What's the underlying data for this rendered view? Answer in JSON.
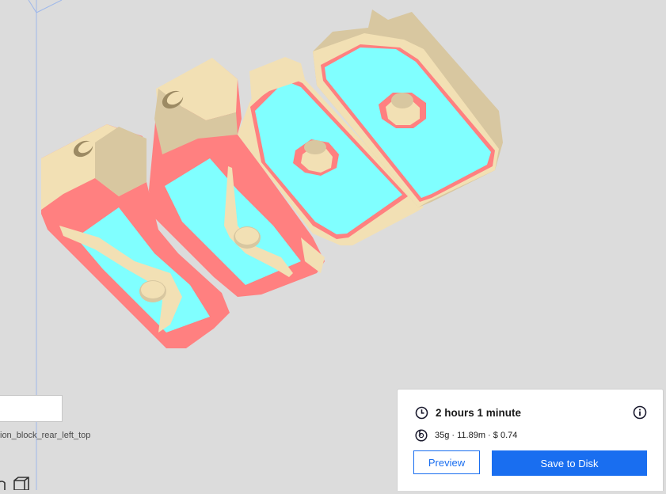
{
  "scene": {
    "object_name_field_value": "",
    "object_name_label": "ion_block_rear_left_top",
    "colors": {
      "background": "#dcdcdc",
      "model_top": "#f2e0b4",
      "model_side": "#d8c7a0",
      "overhang": "#ff8080",
      "top_surface": "#80ffff",
      "build_volume_line": "#9fb8ea"
    }
  },
  "print_panel": {
    "time_icon": "clock-icon",
    "print_time": "2 hours 1 minute",
    "info_icon": "info-icon",
    "material_icon": "spool-icon",
    "material_summary": "35g · 11.89m · $ 0.74",
    "preview_label": "Preview",
    "save_label": "Save to Disk",
    "accent_color": "#196ef0"
  }
}
